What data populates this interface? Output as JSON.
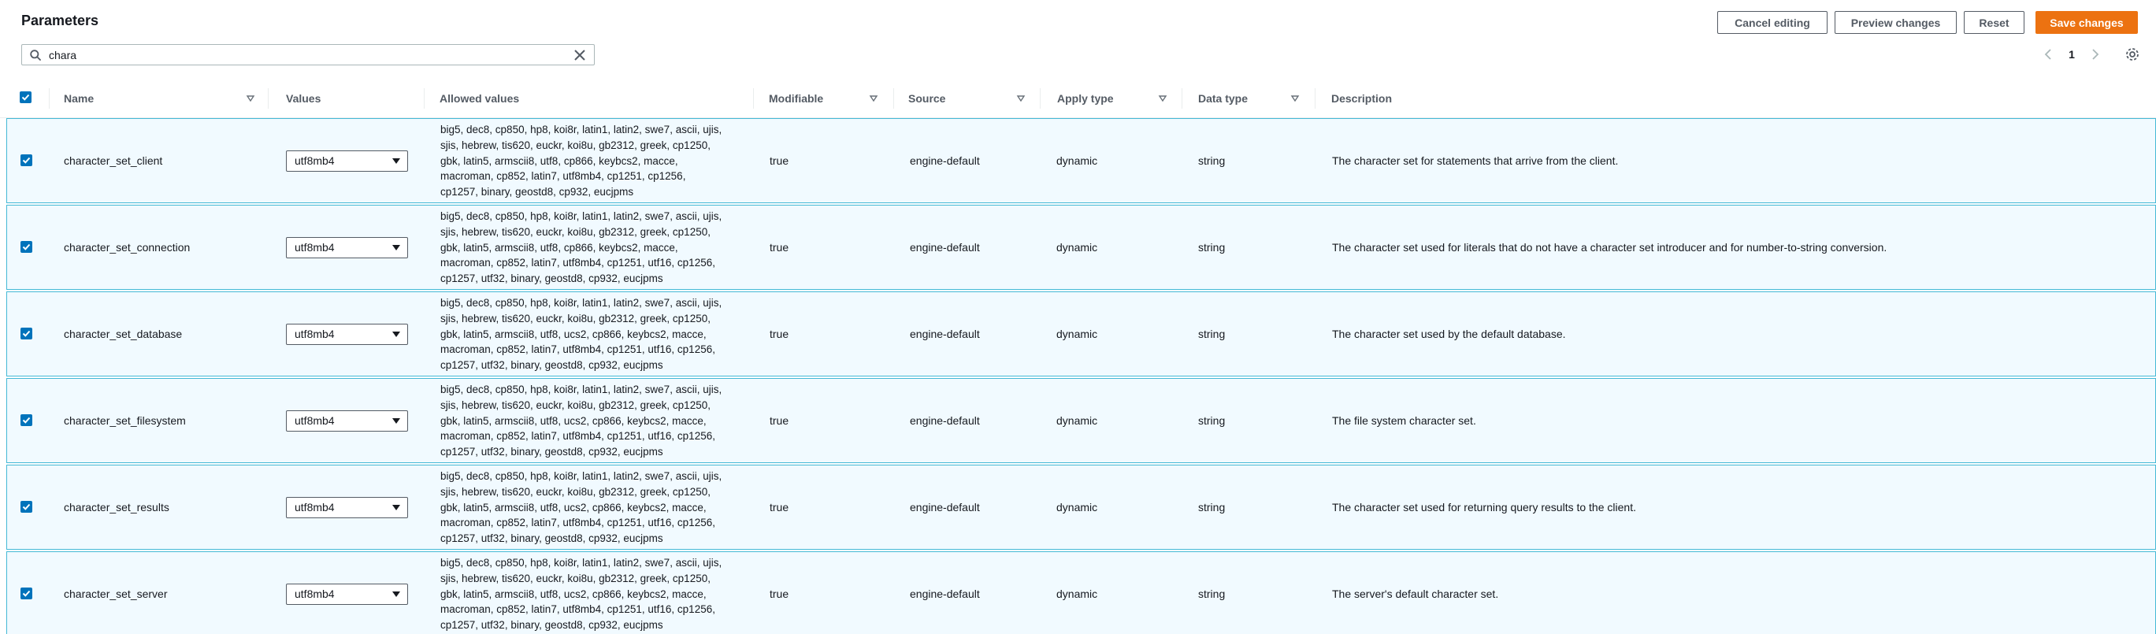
{
  "header": {
    "title": "Parameters",
    "cancel_label": "Cancel editing",
    "preview_label": "Preview changes",
    "reset_label": "Reset",
    "save_label": "Save changes"
  },
  "search": {
    "value": "chara",
    "placeholder": ""
  },
  "pagination": {
    "current_page": "1"
  },
  "table": {
    "columns": {
      "name": "Name",
      "values": "Values",
      "allowed": "Allowed values",
      "modifiable": "Modifiable",
      "source": "Source",
      "apply_type": "Apply type",
      "data_type": "Data type",
      "description": "Description"
    },
    "rows": [
      {
        "name": "character_set_client",
        "value": "utf8mb4",
        "allowed_lines": [
          "big5, dec8, cp850, hp8, koi8r, latin1, latin2, swe7, ascii, ujis,",
          "sjis, hebrew, tis620, euckr, koi8u, gb2312, greek, cp1250,",
          "gbk, latin5, armscii8, utf8, cp866, keybcs2, macce,",
          "macroman, cp852, latin7, utf8mb4, cp1251, cp1256,",
          "cp1257, binary, geostd8, cp932, eucjpms"
        ],
        "modifiable": "true",
        "source": "engine-default",
        "apply_type": "dynamic",
        "data_type": "string",
        "description": "The character set for statements that arrive from the client."
      },
      {
        "name": "character_set_connection",
        "value": "utf8mb4",
        "allowed_lines": [
          "big5, dec8, cp850, hp8, koi8r, latin1, latin2, swe7, ascii, ujis,",
          "sjis, hebrew, tis620, euckr, koi8u, gb2312, greek, cp1250,",
          "gbk, latin5, armscii8, utf8, cp866, keybcs2, macce,",
          "macroman, cp852, latin7, utf8mb4, cp1251, utf16, cp1256,",
          "cp1257, utf32, binary, geostd8, cp932, eucjpms"
        ],
        "modifiable": "true",
        "source": "engine-default",
        "apply_type": "dynamic",
        "data_type": "string",
        "description": "The character set used for literals that do not have a character set introducer and for number-to-string conversion."
      },
      {
        "name": "character_set_database",
        "value": "utf8mb4",
        "allowed_lines": [
          "big5, dec8, cp850, hp8, koi8r, latin1, latin2, swe7, ascii, ujis,",
          "sjis, hebrew, tis620, euckr, koi8u, gb2312, greek, cp1250,",
          "gbk, latin5, armscii8, utf8, ucs2, cp866, keybcs2, macce,",
          "macroman, cp852, latin7, utf8mb4, cp1251, utf16, cp1256,",
          "cp1257, utf32, binary, geostd8, cp932, eucjpms"
        ],
        "modifiable": "true",
        "source": "engine-default",
        "apply_type": "dynamic",
        "data_type": "string",
        "description": "The character set used by the default database."
      },
      {
        "name": "character_set_filesystem",
        "value": "utf8mb4",
        "allowed_lines": [
          "big5, dec8, cp850, hp8, koi8r, latin1, latin2, swe7, ascii, ujis,",
          "sjis, hebrew, tis620, euckr, koi8u, gb2312, greek, cp1250,",
          "gbk, latin5, armscii8, utf8, ucs2, cp866, keybcs2, macce,",
          "macroman, cp852, latin7, utf8mb4, cp1251, utf16, cp1256,",
          "cp1257, utf32, binary, geostd8, cp932, eucjpms"
        ],
        "modifiable": "true",
        "source": "engine-default",
        "apply_type": "dynamic",
        "data_type": "string",
        "description": "The file system character set."
      },
      {
        "name": "character_set_results",
        "value": "utf8mb4",
        "allowed_lines": [
          "big5, dec8, cp850, hp8, koi8r, latin1, latin2, swe7, ascii, ujis,",
          "sjis, hebrew, tis620, euckr, koi8u, gb2312, greek, cp1250,",
          "gbk, latin5, armscii8, utf8, ucs2, cp866, keybcs2, macce,",
          "macroman, cp852, latin7, utf8mb4, cp1251, utf16, cp1256,",
          "cp1257, utf32, binary, geostd8, cp932, eucjpms"
        ],
        "modifiable": "true",
        "source": "engine-default",
        "apply_type": "dynamic",
        "data_type": "string",
        "description": "The character set used for returning query results to the client."
      },
      {
        "name": "character_set_server",
        "value": "utf8mb4",
        "allowed_lines": [
          "big5, dec8, cp850, hp8, koi8r, latin1, latin2, swe7, ascii, ujis,",
          "sjis, hebrew, tis620, euckr, koi8u, gb2312, greek, cp1250,",
          "gbk, latin5, armscii8, utf8, ucs2, cp866, keybcs2, macce,",
          "macroman, cp852, latin7, utf8mb4, cp1251, utf16, cp1256,",
          "cp1257, utf32, binary, geostd8, cp932, eucjpms"
        ],
        "modifiable": "true",
        "source": "engine-default",
        "apply_type": "dynamic",
        "data_type": "string",
        "description": "The server's default character set."
      }
    ]
  },
  "colors": {
    "accent": "#0073bb",
    "primary_button": "#ec7211",
    "row_selected_bg": "#f1faff",
    "row_selected_border": "#44b9d6"
  },
  "icons": [
    "search-icon",
    "close-icon",
    "chevron-left-icon",
    "chevron-right-icon",
    "gear-icon",
    "sort-caret-icon",
    "checkbox-checked-icon",
    "dropdown-caret-icon"
  ]
}
